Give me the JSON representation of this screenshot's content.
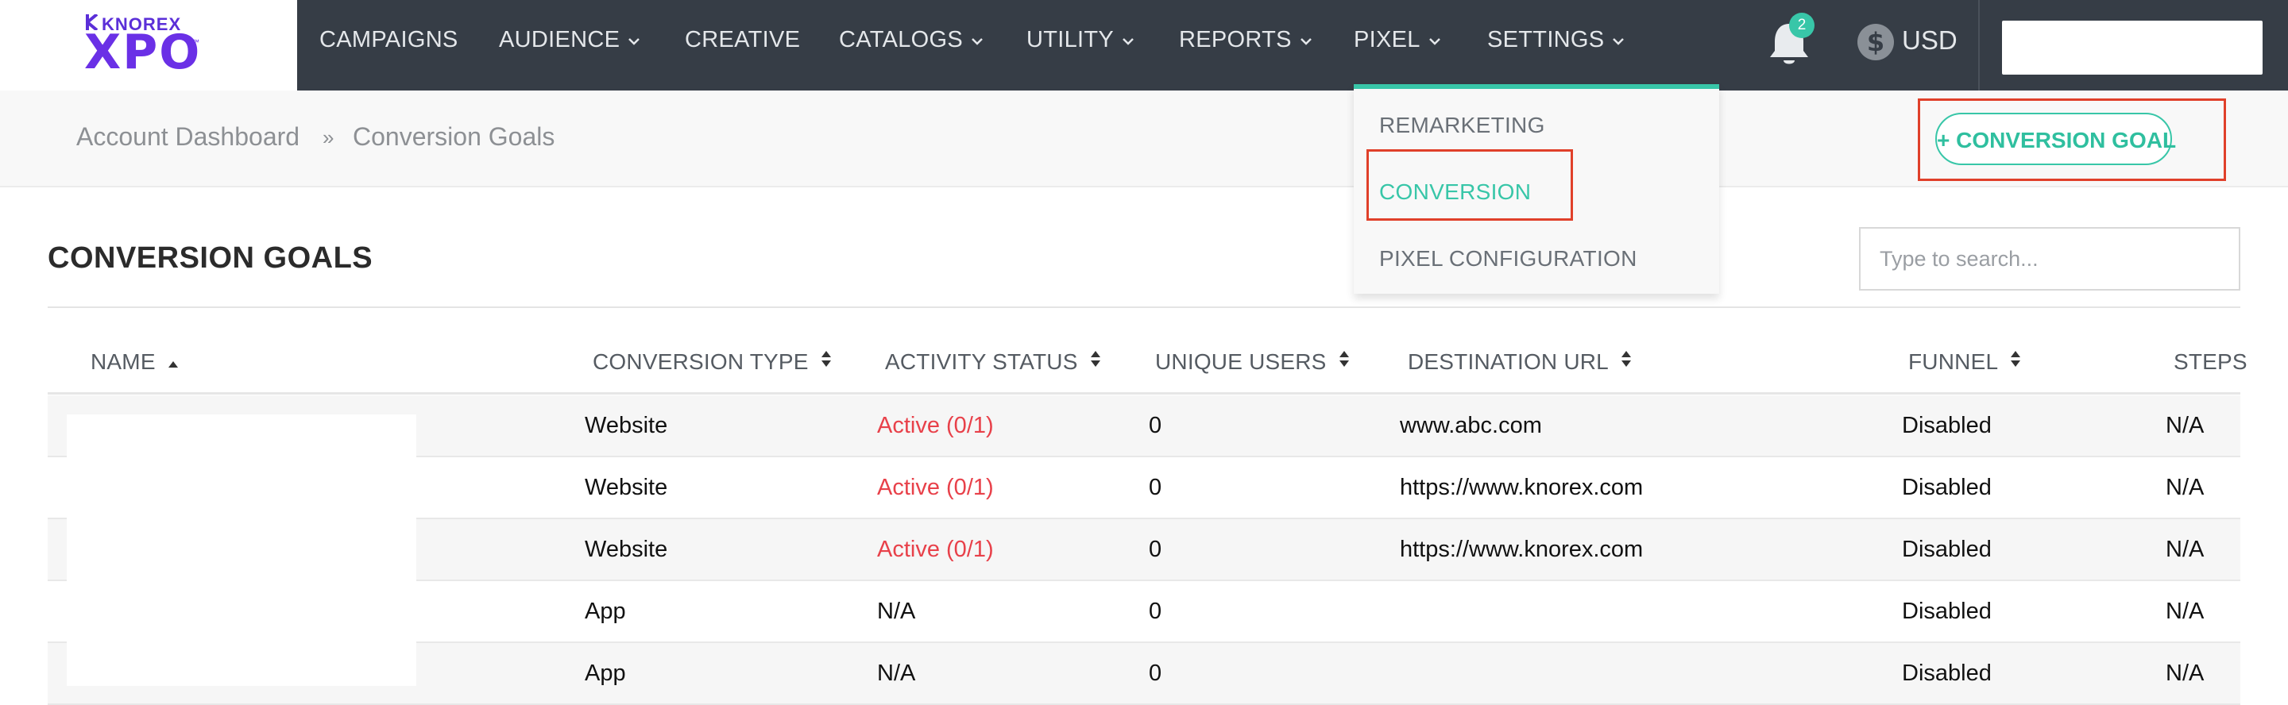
{
  "logo": {
    "brand": "KNOREX",
    "product": "XPO",
    "tm": "™"
  },
  "nav": {
    "items": [
      {
        "label": "CAMPAIGNS",
        "has_caret": false
      },
      {
        "label": "AUDIENCE",
        "has_caret": true
      },
      {
        "label": "CREATIVE",
        "has_caret": false
      },
      {
        "label": "CATALOGS",
        "has_caret": true
      },
      {
        "label": "UTILITY",
        "has_caret": true
      },
      {
        "label": "REPORTS",
        "has_caret": true
      },
      {
        "label": "PIXEL",
        "has_caret": true
      },
      {
        "label": "SETTINGS",
        "has_caret": true
      }
    ],
    "notification_count": "2",
    "currency_symbol": "$",
    "currency": "USD"
  },
  "breadcrumb": {
    "items": [
      "Account Dashboard",
      "Conversion Goals"
    ],
    "separator": "»"
  },
  "actions": {
    "add_label": "+ CONVERSION GOAL"
  },
  "pixel_menu": {
    "items": [
      "REMARKETING",
      "CONVERSION",
      "PIXEL CONFIGURATION"
    ],
    "active": "CONVERSION"
  },
  "page": {
    "title": "CONVERSION GOALS",
    "search_placeholder": "Type to search..."
  },
  "table": {
    "columns": [
      {
        "label": "NAME",
        "sort": "asc"
      },
      {
        "label": "CONVERSION TYPE",
        "sort": "both"
      },
      {
        "label": "ACTIVITY STATUS",
        "sort": "both"
      },
      {
        "label": "UNIQUE USERS",
        "sort": "both"
      },
      {
        "label": "DESTINATION URL",
        "sort": "both"
      },
      {
        "label": "FUNNEL",
        "sort": "both"
      },
      {
        "label": "STEPS",
        "sort": "none"
      }
    ],
    "rows": [
      {
        "type": "Website",
        "status": "Active (0/1)",
        "users": "0",
        "url": "www.abc.com",
        "funnel": "Disabled",
        "steps": "N/A"
      },
      {
        "type": "Website",
        "status": "Active (0/1)",
        "users": "0",
        "url": "https://www.knorex.com",
        "funnel": "Disabled",
        "steps": "N/A"
      },
      {
        "type": "Website",
        "status": "Active (0/1)",
        "users": "0",
        "url": "https://www.knorex.com",
        "funnel": "Disabled",
        "steps": "N/A"
      },
      {
        "type": "App",
        "status": "N/A",
        "users": "0",
        "url": "",
        "funnel": "Disabled",
        "steps": "N/A"
      },
      {
        "type": "App",
        "status": "N/A",
        "users": "0",
        "url": "",
        "funnel": "Disabled",
        "steps": "N/A"
      }
    ]
  },
  "colors": {
    "topbar": "#363d46",
    "accent": "#38c6a8",
    "status_active": "#e8414a",
    "highlight_box": "#e0402a"
  }
}
